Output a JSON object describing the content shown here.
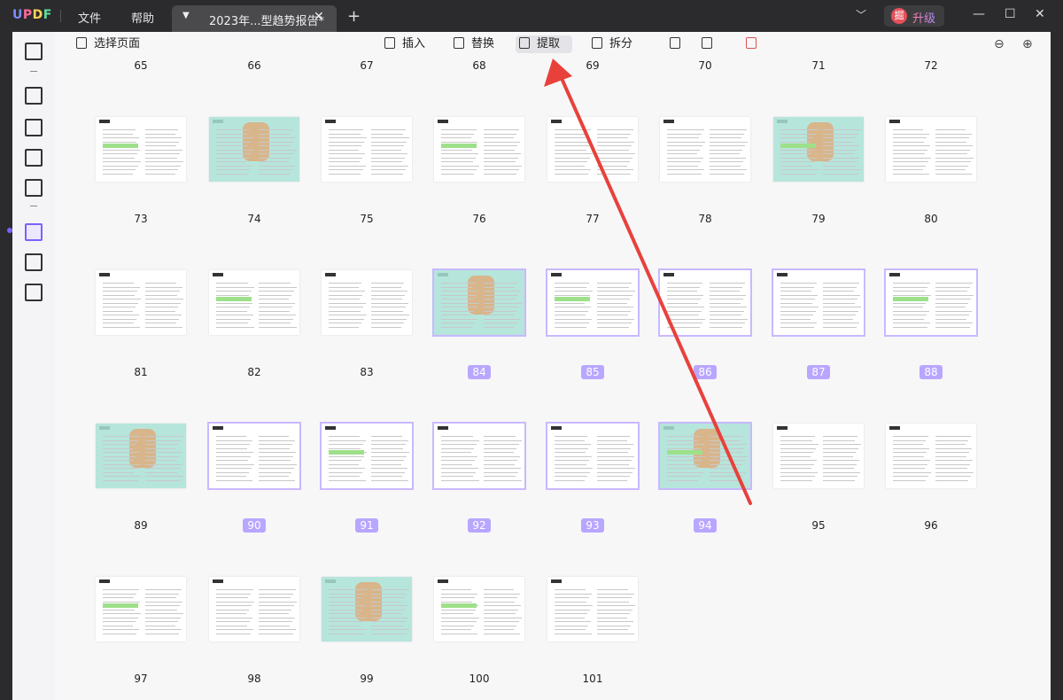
{
  "app": {
    "logo": "UPDF",
    "menus": [
      "文件",
      "帮助"
    ],
    "tab_title": "2023年...型趋势报告*",
    "upgrade": "升级",
    "avatar_char": "掘"
  },
  "toolbar": {
    "select_pages": "选择页面",
    "insert": "插入",
    "replace": "替换",
    "extract": "提取",
    "split": "拆分"
  },
  "rows": [
    {
      "labels": [
        "65",
        "66",
        "67",
        "68",
        "69",
        "70",
        "71",
        "72"
      ],
      "selected": []
    },
    {
      "labels": [
        "73",
        "74",
        "75",
        "76",
        "77",
        "78",
        "79",
        "80"
      ],
      "selected": []
    },
    {
      "labels": [
        "81",
        "82",
        "83",
        "84",
        "85",
        "86",
        "87",
        "88"
      ],
      "selected": [
        "84",
        "85",
        "86",
        "87",
        "88"
      ]
    },
    {
      "labels": [
        "89",
        "90",
        "91",
        "92",
        "93",
        "94",
        "95",
        "96"
      ],
      "selected": [
        "90",
        "91",
        "92",
        "93",
        "94"
      ]
    },
    {
      "labels": [
        "97",
        "98",
        "99",
        "100",
        "101"
      ],
      "selected": []
    }
  ],
  "colors": {
    "accent": "#7b61ff",
    "selected_badge": "#b9a6ff",
    "arrow": "#e8413c"
  }
}
